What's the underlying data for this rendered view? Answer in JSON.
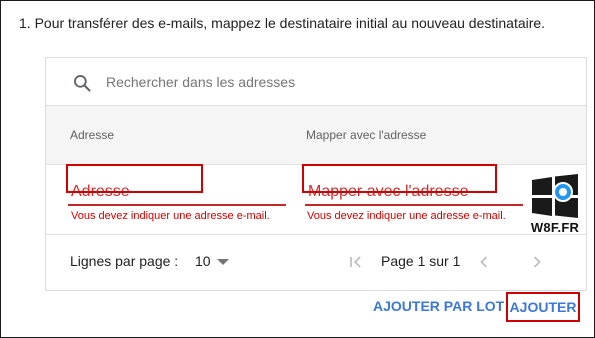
{
  "instruction": "1. Pour transférer des e-mails, mappez le destinataire initial au nouveau destinataire.",
  "search": {
    "placeholder": "Rechercher dans les adresses",
    "icon": "search-icon"
  },
  "table": {
    "headers": {
      "address": "Adresse",
      "mapping": "Mapper avec l'adresse"
    },
    "edit_row": {
      "address_placeholder": "Adresse",
      "mapping_placeholder": "Mapper avec l'adresse",
      "address_error": "Vous devez indiquer une adresse e-mail.",
      "mapping_error": "Vous devez indiquer une adresse e-mail."
    }
  },
  "pagination": {
    "rows_label": "Lignes par page :",
    "rows_value": "10",
    "page_info": "Page 1 sur 1"
  },
  "actions": {
    "bulk_add": "AJOUTER PAR LOT",
    "add": "AJOUTER"
  },
  "watermark": {
    "text": "W8F.FR"
  },
  "colors": {
    "error": "#d50000",
    "accent": "#3c78d8",
    "highlight": "#d00000"
  }
}
